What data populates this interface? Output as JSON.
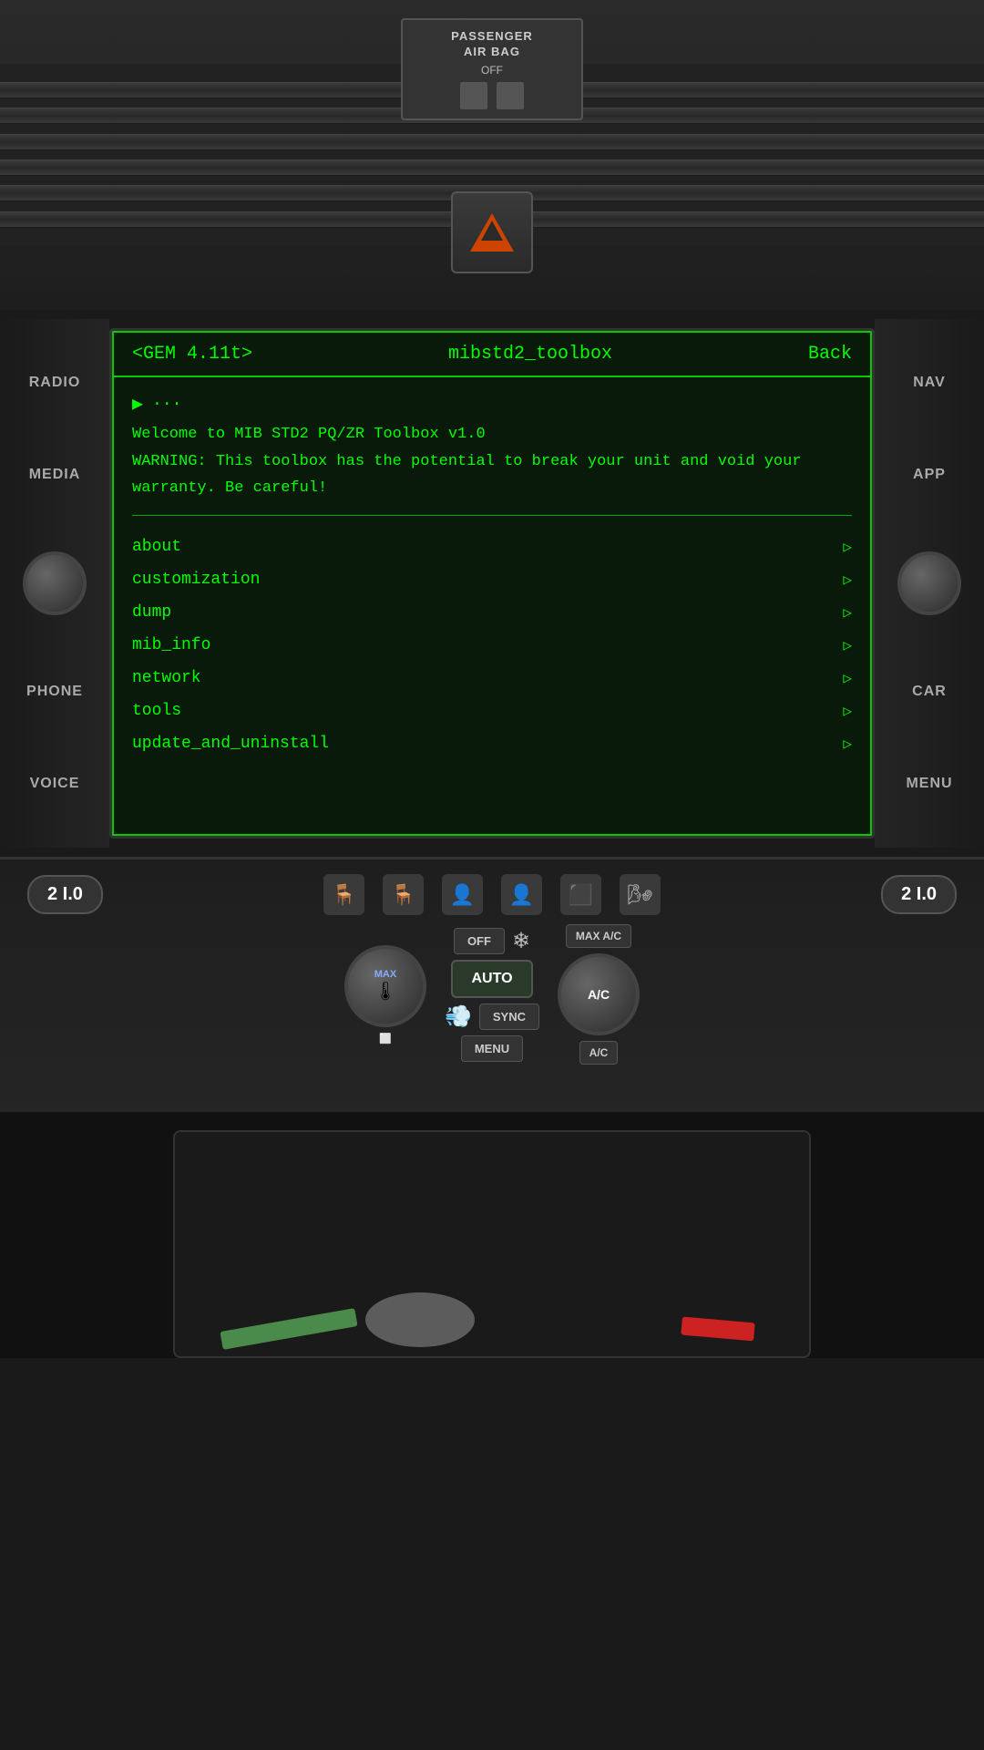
{
  "car": {
    "dashboard": {
      "airbag_label": "PASSENGER\nAIR BAG",
      "airbag_status": "OFF"
    }
  },
  "infotainment": {
    "side_buttons_left": [
      {
        "id": "radio",
        "label": "RADIO"
      },
      {
        "id": "media",
        "label": "MEDIA"
      },
      {
        "id": "phone",
        "label": "PHONE"
      },
      {
        "id": "voice",
        "label": "VOICE"
      }
    ],
    "side_buttons_right": [
      {
        "id": "nav",
        "label": "NAV"
      },
      {
        "id": "app",
        "label": "APP"
      },
      {
        "id": "car",
        "label": "CAR"
      },
      {
        "id": "menu",
        "label": "MENU"
      }
    ],
    "screen": {
      "header": {
        "title_left": "<GEM 4.11t>",
        "title_center": "mibstd2_toolbox",
        "back_button": "Back"
      },
      "prompt_symbol": "▶",
      "prompt_dots": "...",
      "welcome_line1": "Welcome to MIB STD2 PQ/ZR Toolbox v1.0",
      "warning_line1": "WARNING: This toolbox has the potential to break your unit and void your",
      "warning_line2": "warranty. Be careful!",
      "menu_items": [
        {
          "label": "about",
          "arrow": "▷"
        },
        {
          "label": "customization",
          "arrow": "▷"
        },
        {
          "label": "dump",
          "arrow": "▷"
        },
        {
          "label": "mib_info",
          "arrow": "▷"
        },
        {
          "label": "network",
          "arrow": "▷"
        },
        {
          "label": "tools",
          "arrow": "▷"
        },
        {
          "label": "update_and_uninstall",
          "arrow": "▷"
        }
      ]
    }
  },
  "climate": {
    "temp_left": "2 I.0",
    "temp_right": "2 I.0",
    "buttons": {
      "off": "OFF",
      "auto": "AUTO",
      "menu": "MENU",
      "sync": "SYNC",
      "max_front": "MAX",
      "max_ac": "MAX A/C",
      "ac": "A/C"
    }
  },
  "colors": {
    "screen_green": "#00ff00",
    "screen_bg": "#0a1a0a",
    "body_dark": "#1a1a1a",
    "button_gray": "#3a3a3a"
  }
}
